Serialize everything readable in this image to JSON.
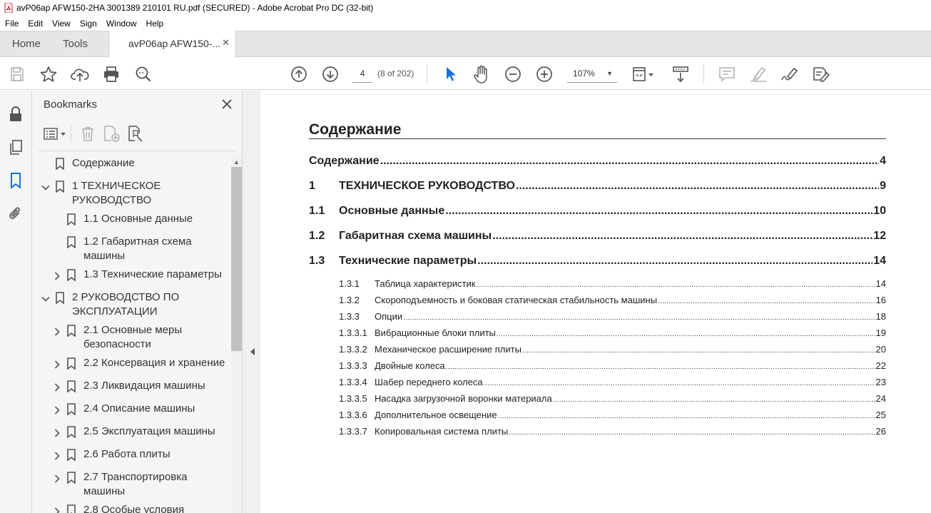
{
  "window": {
    "title": "avP06ap AFW150-2HA 3001389 210101 RU.pdf (SECURED) - Adobe Acrobat Pro DC (32-bit)"
  },
  "menu": [
    "File",
    "Edit",
    "View",
    "Sign",
    "Window",
    "Help"
  ],
  "tabs": {
    "home": "Home",
    "tools": "Tools",
    "document": "avP06ap AFW150-...",
    "close": "✕"
  },
  "toolbar": {
    "page_number": "4",
    "page_of": "(8 of 202)",
    "zoom": "107%",
    "icons": [
      "save-icon",
      "star-icon",
      "upload-icon",
      "print-icon",
      "zoom-search-icon",
      "prev-page-icon",
      "next-page-icon",
      "select-arrow-icon",
      "hand-icon",
      "zoom-out-icon",
      "zoom-in-icon",
      "page-fit-icon",
      "scroll-mode-icon",
      "comment-icon",
      "highlight-icon",
      "sign-icon",
      "fill-sign-icon"
    ]
  },
  "colors": {
    "accent": "#1473e6",
    "bookmark_active": "#1473e6"
  },
  "bookmarks": {
    "title": "Bookmarks",
    "items": [
      {
        "level": 0,
        "expand": "none",
        "label_lines": [
          "Содержание"
        ]
      },
      {
        "level": 0,
        "expand": "expanded",
        "label_lines": [
          "1 ТЕХНИЧЕСКОЕ",
          "РУКОВОДСТВО"
        ]
      },
      {
        "level": 1,
        "expand": "none",
        "label_lines": [
          "1.1 Основные данные"
        ]
      },
      {
        "level": 1,
        "expand": "none",
        "label_lines": [
          "1.2 Габаритная схема",
          "машины"
        ]
      },
      {
        "level": 1,
        "expand": "collapsed",
        "label_lines": [
          "1.3 Технические параметры"
        ]
      },
      {
        "level": 0,
        "expand": "expanded",
        "label_lines": [
          "2 РУКОВОДСТВО ПО",
          "ЭКСПЛУАТАЦИИ"
        ]
      },
      {
        "level": 1,
        "expand": "collapsed",
        "label_lines": [
          "2.1 Основные меры",
          "безопасности"
        ]
      },
      {
        "level": 1,
        "expand": "collapsed",
        "label_lines": [
          "2.2 Консервация и хранение"
        ]
      },
      {
        "level": 1,
        "expand": "collapsed",
        "label_lines": [
          "2.3 Ликвидация машины"
        ]
      },
      {
        "level": 1,
        "expand": "collapsed",
        "label_lines": [
          "2.4 Описание машины"
        ]
      },
      {
        "level": 1,
        "expand": "collapsed",
        "label_lines": [
          "2.5 Эксплуатация машины"
        ]
      },
      {
        "level": 1,
        "expand": "collapsed",
        "label_lines": [
          "2.6 Работа плиты"
        ]
      },
      {
        "level": 1,
        "expand": "collapsed",
        "label_lines": [
          "2.7 Транспортировка",
          "машины"
        ]
      },
      {
        "level": 1,
        "expand": "collapsed",
        "label_lines": [
          "2.8 Особые условия"
        ]
      }
    ]
  },
  "document": {
    "heading": "Содержание",
    "toc_main": [
      {
        "num": "",
        "text": "Содержание",
        "page": "4"
      },
      {
        "num": "1",
        "text": "ТЕХНИЧЕСКОЕ РУКОВОДСТВО",
        "page": "9"
      },
      {
        "num": "1.1",
        "text": "Основные данные",
        "page": "10"
      },
      {
        "num": "1.2",
        "text": "Габаритная схема машины",
        "page": "12"
      },
      {
        "num": "1.3",
        "text": "Технические параметры",
        "page": "14"
      }
    ],
    "toc_sub": [
      {
        "num": "1.3.1",
        "text": "Таблица характеристик",
        "page": "14"
      },
      {
        "num": "1.3.2",
        "text": "Скороподъемность и боковая статическая стабильность машины",
        "page": "16"
      },
      {
        "num": "1.3.3",
        "text": "Опции",
        "page": "18"
      },
      {
        "num": "1.3.3.1",
        "text": "Вибрационные блоки плиты",
        "page": "19"
      },
      {
        "num": "1.3.3.2",
        "text": "Механическое расширение плиты",
        "page": "20"
      },
      {
        "num": "1.3.3.3",
        "text": "Двойные колеса",
        "page": "22"
      },
      {
        "num": "1.3.3.4",
        "text": "Шабер переднего колеса",
        "page": "23"
      },
      {
        "num": "1.3.3.5",
        "text": "Насадка загрузочной воронки материала",
        "page": "24"
      },
      {
        "num": "1.3.3.6",
        "text": "Дополнительное освещение",
        "page": "25"
      },
      {
        "num": "1.3.3.7",
        "text": "Копировальная система плиты",
        "page": "26"
      }
    ]
  }
}
